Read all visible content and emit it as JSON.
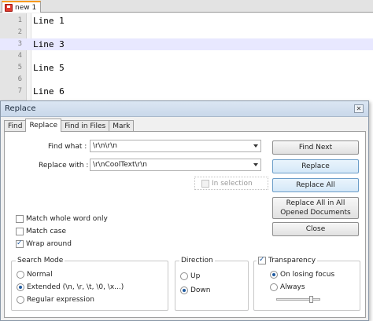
{
  "tab": {
    "label": "new 1",
    "icon": "save-icon"
  },
  "editor": {
    "current_line": 3,
    "lines": [
      {
        "num": "1",
        "text": "Line 1"
      },
      {
        "num": "2",
        "text": ""
      },
      {
        "num": "3",
        "text": "Line 3"
      },
      {
        "num": "4",
        "text": ""
      },
      {
        "num": "5",
        "text": "Line 5"
      },
      {
        "num": "6",
        "text": ""
      },
      {
        "num": "7",
        "text": "Line 6"
      }
    ]
  },
  "dialog": {
    "title": "Replace",
    "close_icon": "close-icon",
    "tabs": [
      "Find",
      "Replace",
      "Find in Files",
      "Mark"
    ],
    "active_tab": "Replace",
    "find_label": "Find what :",
    "find_value": "\\r\\n\\r\\n",
    "replace_label": "Replace with :",
    "replace_value": "\\r\\nCoolText\\r\\n",
    "in_selection": "In selection",
    "buttons": {
      "find_next": "Find Next",
      "replace": "Replace",
      "replace_all": "Replace All",
      "replace_all_opened": "Replace All in All Opened Documents",
      "close": "Close"
    },
    "options": {
      "match_whole_word": "Match whole word only",
      "match_case": "Match case",
      "wrap_around": "Wrap around"
    },
    "search_mode": {
      "title": "Search Mode",
      "normal": "Normal",
      "extended": "Extended (\\n, \\r, \\t, \\0, \\x...)",
      "regex": "Regular expression",
      "selected": "extended"
    },
    "direction": {
      "title": "Direction",
      "up": "Up",
      "down": "Down",
      "selected": "down"
    },
    "transparency": {
      "title": "Transparency",
      "on_losing_focus": "On losing focus",
      "always": "Always",
      "selected": "on_losing_focus",
      "slider_level": 0.8
    }
  }
}
